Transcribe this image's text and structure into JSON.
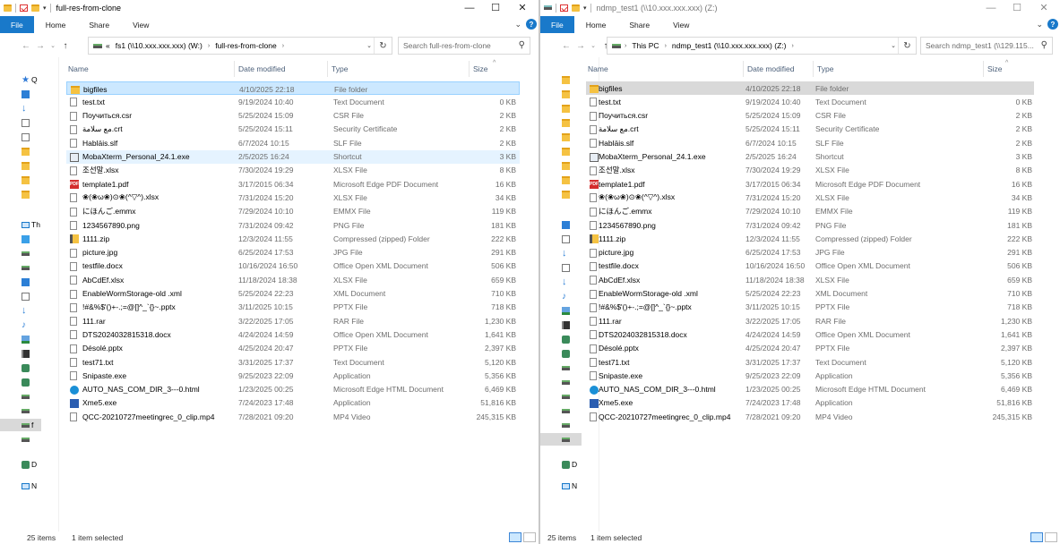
{
  "windows": {
    "left": {
      "title": "full-res-from-clone",
      "title_dim": false,
      "ribbon_tabs": [
        "File",
        "Home",
        "Share",
        "View"
      ],
      "address": {
        "prefix": "«",
        "segments": [
          "fs1 (\\\\10.xxx.xxx.xxx) (W:)",
          "full-res-from-clone"
        ]
      },
      "search_placeholder": "Search full-res-from-clone",
      "status": {
        "items_count": "25 items",
        "selected": "1 item selected"
      },
      "selected_row": 0,
      "selection_style": "blue",
      "nav_labels": [
        "Q",
        "Th",
        "f",
        "D",
        "N"
      ]
    },
    "right": {
      "title": "ndmp_test1 (\\\\10.xxx.xxx.xxx) (Z:)",
      "title_dim": true,
      "ribbon_tabs": [
        "File",
        "Home",
        "Share",
        "View"
      ],
      "address": {
        "prefix": "",
        "segments": [
          "This PC",
          "ndmp_test1 (\\\\10.xxx.xxx.xxx) (Z:)"
        ]
      },
      "search_placeholder": "Search ndmp_test1 (\\\\129.115...",
      "status": {
        "items_count": "25 items",
        "selected": "1 item selected"
      },
      "selected_row": 0,
      "selection_style": "grey",
      "nav_labels": [
        "D",
        "N"
      ]
    }
  },
  "columns": {
    "name": "Name",
    "date": "Date modified",
    "type": "Type",
    "size": "Size"
  },
  "files": [
    {
      "name": "bigfiles",
      "date": "4/10/2025 22:18",
      "type": "File folder",
      "size": "",
      "icon": "folder"
    },
    {
      "name": "test.txt",
      "date": "9/19/2024 10:40",
      "type": "Text Document",
      "size": "0 KB",
      "icon": "doc"
    },
    {
      "name": "Поучиться.csr",
      "date": "5/25/2024 15:09",
      "type": "CSR File",
      "size": "2 KB",
      "icon": "doc"
    },
    {
      "name": "مع سلامة.crt",
      "date": "5/25/2024 15:11",
      "type": "Security Certificate",
      "size": "2 KB",
      "icon": "doc"
    },
    {
      "name": "Habläis.slf",
      "date": "6/7/2024 10:15",
      "type": "SLF File",
      "size": "2 KB",
      "icon": "doc"
    },
    {
      "name": "MobaXterm_Personal_24.1.exe",
      "date": "2/5/2025 16:24",
      "type": "Shortcut",
      "size": "3 KB",
      "icon": "shortcut"
    },
    {
      "name": "조선말.xlsx",
      "date": "7/30/2024 19:29",
      "type": "XLSX File",
      "size": "8 KB",
      "icon": "doc"
    },
    {
      "name": "template1.pdf",
      "date": "3/17/2015 06:34",
      "type": "Microsoft Edge PDF Document",
      "size": "16 KB",
      "icon": "pdf"
    },
    {
      "name": "❀(❀ω❀)⊙❀(^▽^).xlsx",
      "date": "7/31/2024 15:20",
      "type": "XLSX File",
      "size": "34 KB",
      "icon": "doc"
    },
    {
      "name": "にほんご.emmx",
      "date": "7/29/2024 10:10",
      "type": "EMMX File",
      "size": "119 KB",
      "icon": "doc"
    },
    {
      "name": "1234567890.png",
      "date": "7/31/2024 09:42",
      "type": "PNG File",
      "size": "181 KB",
      "icon": "doc"
    },
    {
      "name": "1111.zip",
      "date": "12/3/2024 11:55",
      "type": "Compressed (zipped) Folder",
      "size": "222 KB",
      "icon": "zip"
    },
    {
      "name": "picture.jpg",
      "date": "6/25/2024 17:53",
      "type": "JPG File",
      "size": "291 KB",
      "icon": "doc"
    },
    {
      "name": "testfile.docx",
      "date": "10/16/2024 16:50",
      "type": "Office Open XML Document",
      "size": "506 KB",
      "icon": "doc"
    },
    {
      "name": "AbCdEf.xlsx",
      "date": "11/18/2024 18:38",
      "type": "XLSX File",
      "size": "659 KB",
      "icon": "doc"
    },
    {
      "name": "EnableWormStorage-old .xml",
      "date": "5/25/2024 22:23",
      "type": "XML Document",
      "size": "710 KB",
      "icon": "doc"
    },
    {
      "name": "!#&%$'()+-.;=@[]^_`{}~.pptx",
      "date": "3/11/2025 10:15",
      "type": "PPTX File",
      "size": "718 KB",
      "icon": "doc"
    },
    {
      "name": "111.rar",
      "date": "3/22/2025 17:05",
      "type": "RAR File",
      "size": "1,230 KB",
      "icon": "doc"
    },
    {
      "name": "DTS2024032815318.docx",
      "date": "4/24/2024 14:59",
      "type": "Office Open XML Document",
      "size": "1,641 KB",
      "icon": "doc"
    },
    {
      "name": "Désolé.pptx",
      "date": "4/25/2024 20:47",
      "type": "PPTX File",
      "size": "2,397 KB",
      "icon": "doc"
    },
    {
      "name": "test71.txt",
      "date": "3/31/2025 17:37",
      "type": "Text Document",
      "size": "5,120 KB",
      "icon": "doc"
    },
    {
      "name": "Snipaste.exe",
      "date": "9/25/2023 22:09",
      "type": "Application",
      "size": "5,356 KB",
      "icon": "doc"
    },
    {
      "name": "AUTO_NAS_COM_DIR_3---0.html",
      "date": "1/23/2025 00:25",
      "type": "Microsoft Edge HTML Document",
      "size": "6,469 KB",
      "icon": "edge"
    },
    {
      "name": "Xme5.exe",
      "date": "7/24/2023 17:48",
      "type": "Application",
      "size": "51,816 KB",
      "icon": "app"
    },
    {
      "name": "QCC-20210727meetingrec_0_clip.mp4",
      "date": "7/28/2021 09:20",
      "type": "MP4 Video",
      "size": "245,315 KB",
      "icon": "doc"
    }
  ]
}
